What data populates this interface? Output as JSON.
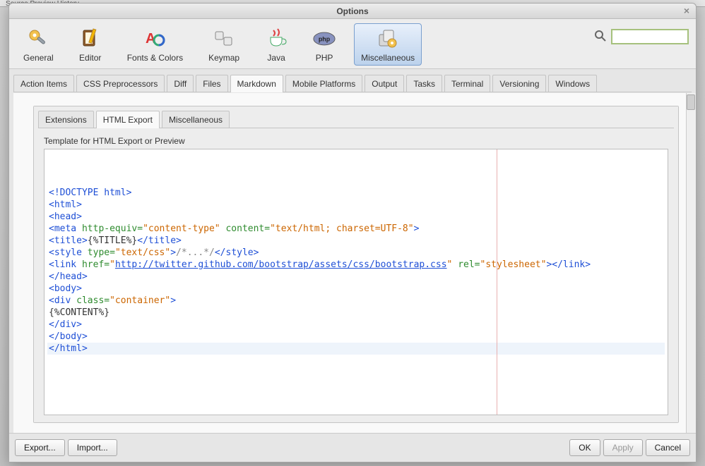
{
  "backdrop": {
    "tabs": "Source   Preview   History"
  },
  "window": {
    "title": "Options"
  },
  "categories": [
    {
      "id": "general",
      "label": "General"
    },
    {
      "id": "editor",
      "label": "Editor"
    },
    {
      "id": "fonts",
      "label": "Fonts & Colors"
    },
    {
      "id": "keymap",
      "label": "Keymap"
    },
    {
      "id": "java",
      "label": "Java"
    },
    {
      "id": "php",
      "label": "PHP"
    },
    {
      "id": "misc",
      "label": "Miscellaneous",
      "selected": true
    }
  ],
  "search": {
    "placeholder": ""
  },
  "primary_tabs": [
    "Action Items",
    "CSS Preprocessors",
    "Diff",
    "Files",
    "Markdown",
    "Mobile Platforms",
    "Output",
    "Tasks",
    "Terminal",
    "Versioning",
    "Windows"
  ],
  "primary_active": "Markdown",
  "sub_tabs": [
    "Extensions",
    "HTML Export",
    "Miscellaneous"
  ],
  "sub_active": "HTML Export",
  "section_label": "Template for HTML Export or Preview",
  "code_lines": [
    {
      "t": "doctype",
      "raw": "<!DOCTYPE html>"
    },
    {
      "t": "tag",
      "name": "html",
      "open": true
    },
    {
      "t": "tag",
      "name": "head",
      "open": true
    },
    {
      "t": "meta",
      "attrs": [
        [
          "http-equiv",
          "content-type"
        ],
        [
          "content",
          "text/html; charset=UTF-8"
        ]
      ]
    },
    {
      "t": "title",
      "inner": "{%TITLE%}"
    },
    {
      "t": "style",
      "type": "text/css",
      "inner": "/*...*/"
    },
    {
      "t": "link",
      "href": "http://twitter.github.com/bootstrap/assets/css/bootstrap.css",
      "rel": "stylesheet"
    },
    {
      "t": "tag",
      "name": "head",
      "close": true
    },
    {
      "t": "tag",
      "name": "body",
      "open": true
    },
    {
      "t": "div",
      "cls": "container"
    },
    {
      "t": "text",
      "raw": "{%CONTENT%}"
    },
    {
      "t": "tag",
      "name": "div",
      "close": true
    },
    {
      "t": "tag",
      "name": "body",
      "close": true
    },
    {
      "t": "tag",
      "name": "html",
      "close": true,
      "current": true
    }
  ],
  "footer": {
    "export": "Export...",
    "import": "Import...",
    "ok": "OK",
    "apply": "Apply",
    "cancel": "Cancel"
  }
}
